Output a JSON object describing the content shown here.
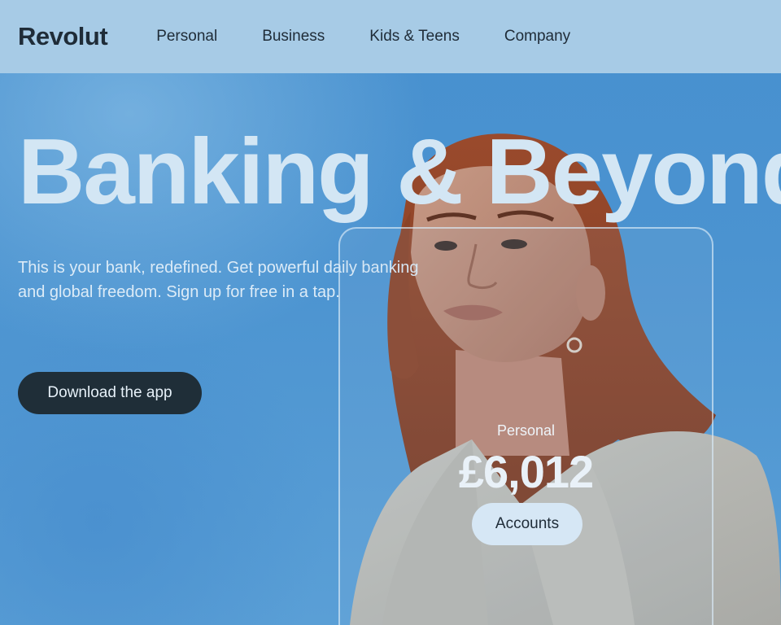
{
  "brand": {
    "logo": "Revolut"
  },
  "nav": {
    "items": [
      {
        "label": "Personal"
      },
      {
        "label": "Business"
      },
      {
        "label": "Kids & Teens"
      },
      {
        "label": "Company"
      }
    ]
  },
  "hero": {
    "headline": "Banking & Beyond",
    "subtext": "This is your bank, redefined. Get powerful daily banking and global freedom. Sign up for free in a tap.",
    "cta_label": "Download the app"
  },
  "card": {
    "label": "Personal",
    "amount": "£6,012",
    "button_label": "Accounts"
  },
  "colors": {
    "header_bg": "#a7cbe6",
    "dark": "#1f2c38",
    "sky": "#4790cf",
    "headline": "#d3e6f4"
  }
}
